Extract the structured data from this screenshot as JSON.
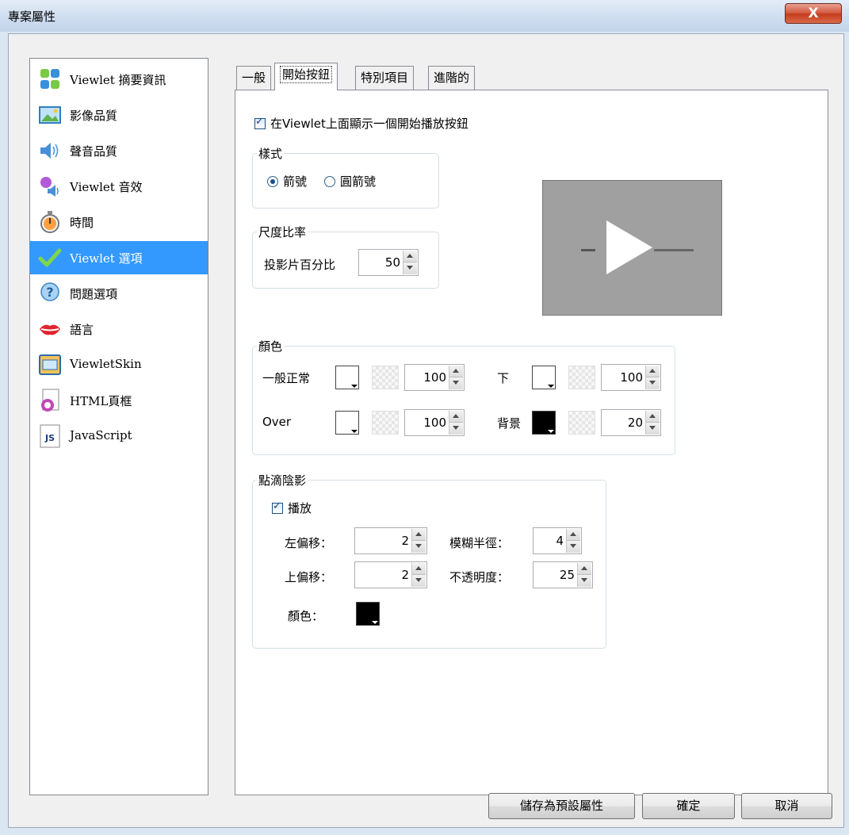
{
  "window": {
    "title": "專案屬性",
    "close_glyph": "X"
  },
  "sidebar": {
    "items": [
      {
        "label": "Viewlet 摘要資訊",
        "icon": "summary-icon"
      },
      {
        "label": "影像品質",
        "icon": "image-icon"
      },
      {
        "label": "聲音品質",
        "icon": "speaker-icon"
      },
      {
        "label": "Viewlet 音效",
        "icon": "sound-effect-icon"
      },
      {
        "label": "時間",
        "icon": "stopwatch-icon"
      },
      {
        "label": "Viewlet 選項",
        "icon": "checkmark-icon",
        "selected": true
      },
      {
        "label": "問題選項",
        "icon": "question-icon"
      },
      {
        "label": "語言",
        "icon": "lips-icon"
      },
      {
        "label": "ViewletSkin",
        "icon": "skin-window-icon"
      },
      {
        "label": "HTML頁框",
        "icon": "html-frame-icon"
      },
      {
        "label": "JavaScript",
        "icon": "javascript-icon"
      }
    ]
  },
  "tabs": [
    {
      "label": "一般"
    },
    {
      "label": "開始按鈕",
      "active": true
    },
    {
      "label": "特別項目"
    },
    {
      "label": "進階的"
    }
  ],
  "start_button": {
    "show_label": "在Viewlet上面顯示一個開始播放按鈕",
    "show_checked": true,
    "style": {
      "title": "樣式",
      "options": [
        "箭號",
        "圓箭號"
      ],
      "selected": "箭號"
    },
    "scale": {
      "title": "尺度比率",
      "label": "投影片百分比",
      "value": "50"
    },
    "colors": {
      "title": "顏色",
      "normal": {
        "label": "一般正常",
        "value": "100",
        "swatch": "#ffffff"
      },
      "down": {
        "label": "下",
        "value": "100",
        "swatch": "#ffffff"
      },
      "over": {
        "label": "Over",
        "value": "100",
        "swatch": "#ffffff"
      },
      "background": {
        "label": "背景",
        "value": "20",
        "swatch": "#000000"
      }
    },
    "shadow": {
      "title": "點滴陰影",
      "play_label": "播放",
      "play_checked": true,
      "left_offset": {
        "label": "左偏移：",
        "value": "2"
      },
      "blur_radius": {
        "label": "模糊半徑：",
        "value": "4"
      },
      "top_offset": {
        "label": "上偏移：",
        "value": "2"
      },
      "opacity": {
        "label": "不透明度：",
        "value": "25"
      },
      "color": {
        "label": "顏色：",
        "swatch": "#000000"
      }
    }
  },
  "footer": {
    "save_default": "儲存為預設屬性",
    "ok": "確定",
    "cancel": "取消"
  }
}
